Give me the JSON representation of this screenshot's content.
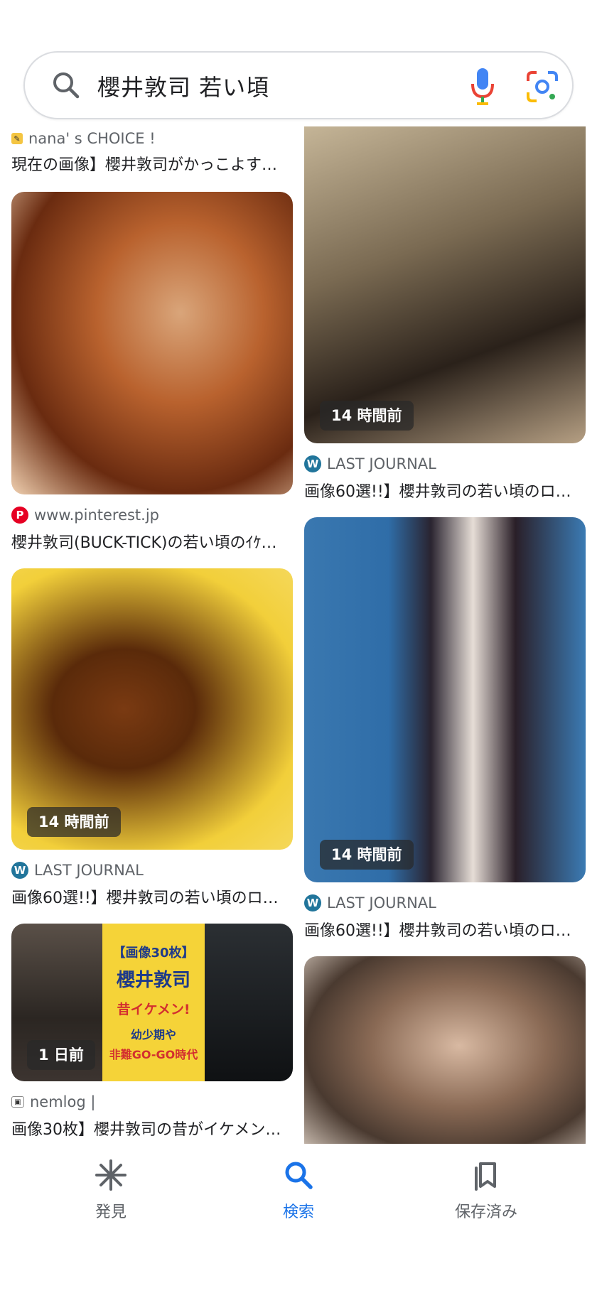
{
  "search": {
    "query": "櫻井敦司 若い頃"
  },
  "results": {
    "left": [
      {
        "source": "nana' s CHOICE !",
        "title": "現在の画像】櫻井敦司がかっこよす…",
        "source_icon": "nana-icon"
      },
      {
        "source": "www.pinterest.jp",
        "title": "櫻井敦司(BUCK-TICK)の若い頃のｲｹ…",
        "source_icon": "pinterest-icon"
      },
      {
        "badge": "14 時間前",
        "source": "LAST JOURNAL",
        "title": "画像60選!!】櫻井敦司の若い頃のロ…",
        "source_icon": "wordpress-icon"
      },
      {
        "badge": "1 日前",
        "source": "nemlog |",
        "title": "画像30枚】櫻井敦司の昔がイケメン…",
        "source_icon": "nemlog-icon",
        "thumb_text": {
          "line1": "【画像30枚】",
          "line2": "櫻井敦司",
          "line3": "昔イケメン!",
          "line4": "幼少期や",
          "line5": "非難GO-GO時代"
        }
      }
    ],
    "right": [
      {
        "badge": "14 時間前",
        "source": "LAST JOURNAL",
        "title": "画像60選!!】櫻井敦司の若い頃のロ…",
        "source_icon": "wordpress-icon"
      },
      {
        "badge": "14 時間前",
        "source": "LAST JOURNAL",
        "title": "画像60選!!】櫻井敦司の若い頃のロ…",
        "source_icon": "wordpress-icon"
      }
    ]
  },
  "nav": {
    "discover": "発見",
    "search": "検索",
    "saved": "保存済み"
  },
  "colors": {
    "accent": "#1a73e8",
    "pinterest": "#e60023",
    "wordpress": "#21759b"
  }
}
